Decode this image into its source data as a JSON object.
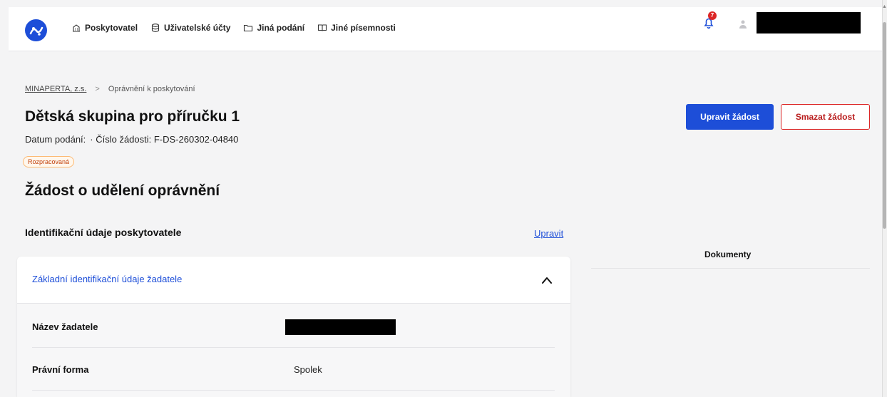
{
  "nav": {
    "items": [
      {
        "label": "Poskytovatel",
        "icon": "building-icon"
      },
      {
        "label": "Uživatelské účty",
        "icon": "database-icon"
      },
      {
        "label": "Jiná podání",
        "icon": "folder-icon"
      },
      {
        "label": "Jiné písemnosti",
        "icon": "book-icon"
      }
    ],
    "notification_count": "7"
  },
  "breadcrumb": {
    "root": "MINAPERTA, z.s.",
    "current": "Oprávnění k poskytování"
  },
  "header": {
    "title": "Dětská skupina pro příručku 1",
    "date_label": "Datum podání:",
    "request_number": "· Číslo žádosti: F-DS-260302-04840",
    "status": "Rozpracovaná",
    "edit_button": "Upravit žádost",
    "delete_button": "Smazat žádost"
  },
  "main": {
    "section_title": "Žádost o udělení oprávnění",
    "subsection_title": "Identifikační údaje poskytovatele",
    "edit_link": "Upravit",
    "card_title": "Základní identifikační údaje žadatele",
    "rows": [
      {
        "label": "Název žadatele",
        "value": ""
      },
      {
        "label": "Právní forma",
        "value": "Spolek"
      }
    ]
  },
  "aside": {
    "documents_label": "Dokumenty"
  },
  "colors": {
    "accent": "#1d4ed8",
    "danger": "#dc2626",
    "status": "#c2410c"
  }
}
